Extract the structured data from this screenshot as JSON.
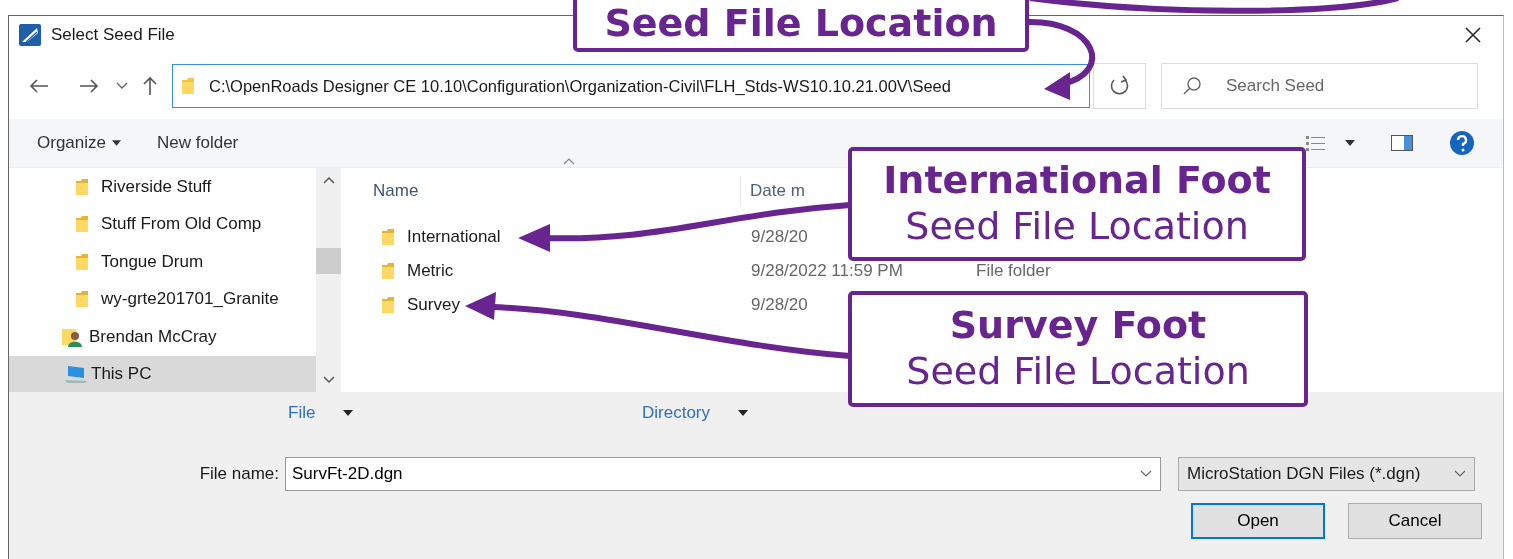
{
  "window": {
    "title": "Select Seed File"
  },
  "address": {
    "path": "C:\\OpenRoads Designer CE 10.10\\Configuration\\Organization-Civil\\FLH_Stds-WS10.10.21.00V\\Seed",
    "search_placeholder": "Search Seed"
  },
  "toolbar": [
    {
      "label": "Organize",
      "dropdown": true
    },
    {
      "label": "New folder",
      "dropdown": false
    }
  ],
  "nav": [
    {
      "label": "Riverside Stuff",
      "kind": "folder",
      "selected": false
    },
    {
      "label": "Stuff From Old Comp",
      "kind": "folder",
      "selected": false
    },
    {
      "label": "Tongue Drum",
      "kind": "folder",
      "selected": false
    },
    {
      "label": "wy-grte201701_Granite",
      "kind": "folder",
      "selected": false
    },
    {
      "label": "Brendan McCray",
      "kind": "user",
      "selected": false
    },
    {
      "label": "This PC",
      "kind": "pc",
      "selected": true
    }
  ],
  "columns": [
    {
      "label": "Name",
      "sorted": true
    },
    {
      "label": "Date m",
      "sorted": false
    }
  ],
  "files": [
    {
      "name": "International",
      "date": "9/28/20"
    },
    {
      "name": "Metric",
      "date": "9/28/2022 11:59 PM",
      "type": "File folder"
    },
    {
      "name": "Survey",
      "date": "9/28/20"
    }
  ],
  "filters": [
    {
      "label": "File"
    },
    {
      "label": "Directory"
    }
  ],
  "file_name": {
    "label": "File name:",
    "value": "SurvFt-2D.dgn"
  },
  "file_type": "MicroStation DGN Files (*.dgn)",
  "buttons": [
    {
      "label": "Open",
      "default": true
    },
    {
      "label": "Cancel",
      "default": false
    }
  ],
  "callouts": [
    {
      "lines": [
        {
          "text": "Seed File Location",
          "bold": true
        }
      ]
    },
    {
      "lines": [
        {
          "text": "International Foot",
          "bold": true
        },
        {
          "text": "Seed File Location",
          "bold": false
        }
      ]
    },
    {
      "lines": [
        {
          "text": "Survey Foot",
          "bold": true
        },
        {
          "text": "Seed File Location",
          "bold": false
        }
      ]
    }
  ]
}
